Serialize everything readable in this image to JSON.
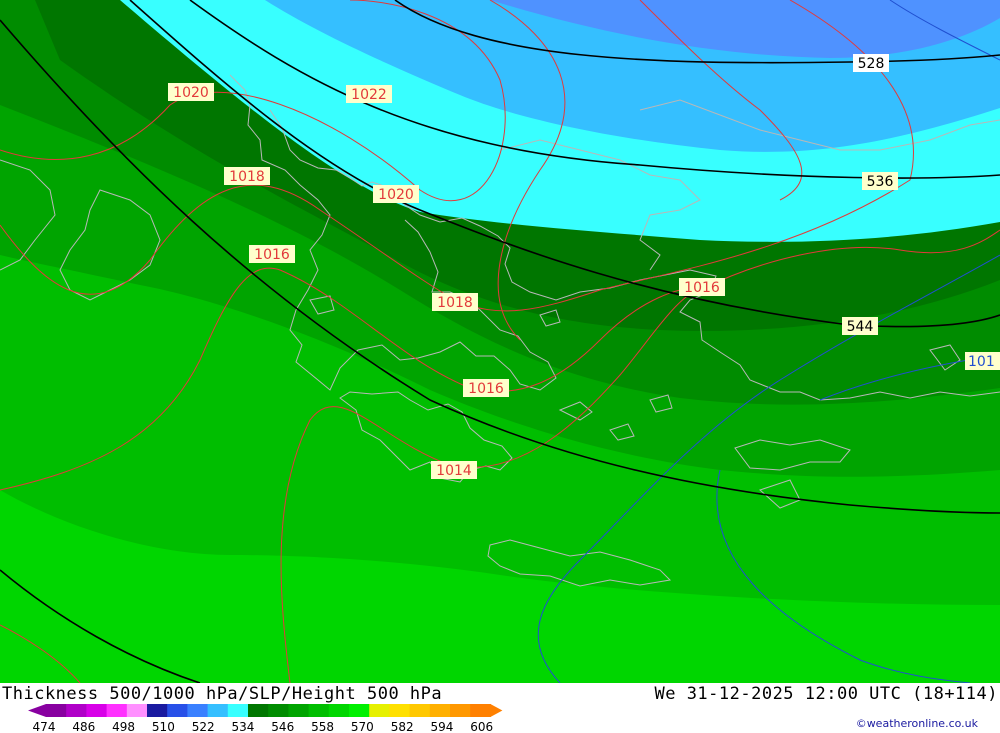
{
  "map": {
    "contour_labels": {
      "thickness": [
        "528",
        "536",
        "544"
      ],
      "slp_top": [
        "1020",
        "1022",
        "1018",
        "1020",
        "1016",
        "1018",
        "1016",
        "1016",
        "1014"
      ],
      "slp_blue": "101"
    },
    "colors": {
      "thickness_blue_dark": "#4f92ff",
      "thickness_blue": "#35bfff",
      "thickness_cyan": "#38ffff",
      "green_darkest": "#007600",
      "green_dark": "#008c00",
      "green_mid": "#00a400",
      "green": "#00be00",
      "green_light": "#00d600",
      "slp_line": "#e23a3a",
      "slp_line_blue": "#2050d0",
      "coast": "#b8b8b8",
      "label_bg": "#ffffcc"
    }
  },
  "footer": {
    "title_left": "Thickness 500/1000 hPa/SLP/Height 500 hPa",
    "title_right": "We 31-12-2025 12:00 UTC (18+114)",
    "credit": "©weatheronline.co.uk",
    "legend_ticks": [
      "474",
      "486",
      "498",
      "510",
      "522",
      "534",
      "546",
      "558",
      "570",
      "582",
      "594",
      "606"
    ],
    "legend_colors": [
      "#8800a0",
      "#b000c8",
      "#d800e8",
      "#ff30ff",
      "#ff90ff",
      "#1a1aa0",
      "#2850e8",
      "#3a80ff",
      "#35bfff",
      "#38ffff",
      "#007600",
      "#008c00",
      "#00a400",
      "#00be00",
      "#00d600",
      "#00f000",
      "#e6f000",
      "#ffe000",
      "#ffc800",
      "#ffb000",
      "#ff9800",
      "#ff8000"
    ]
  }
}
